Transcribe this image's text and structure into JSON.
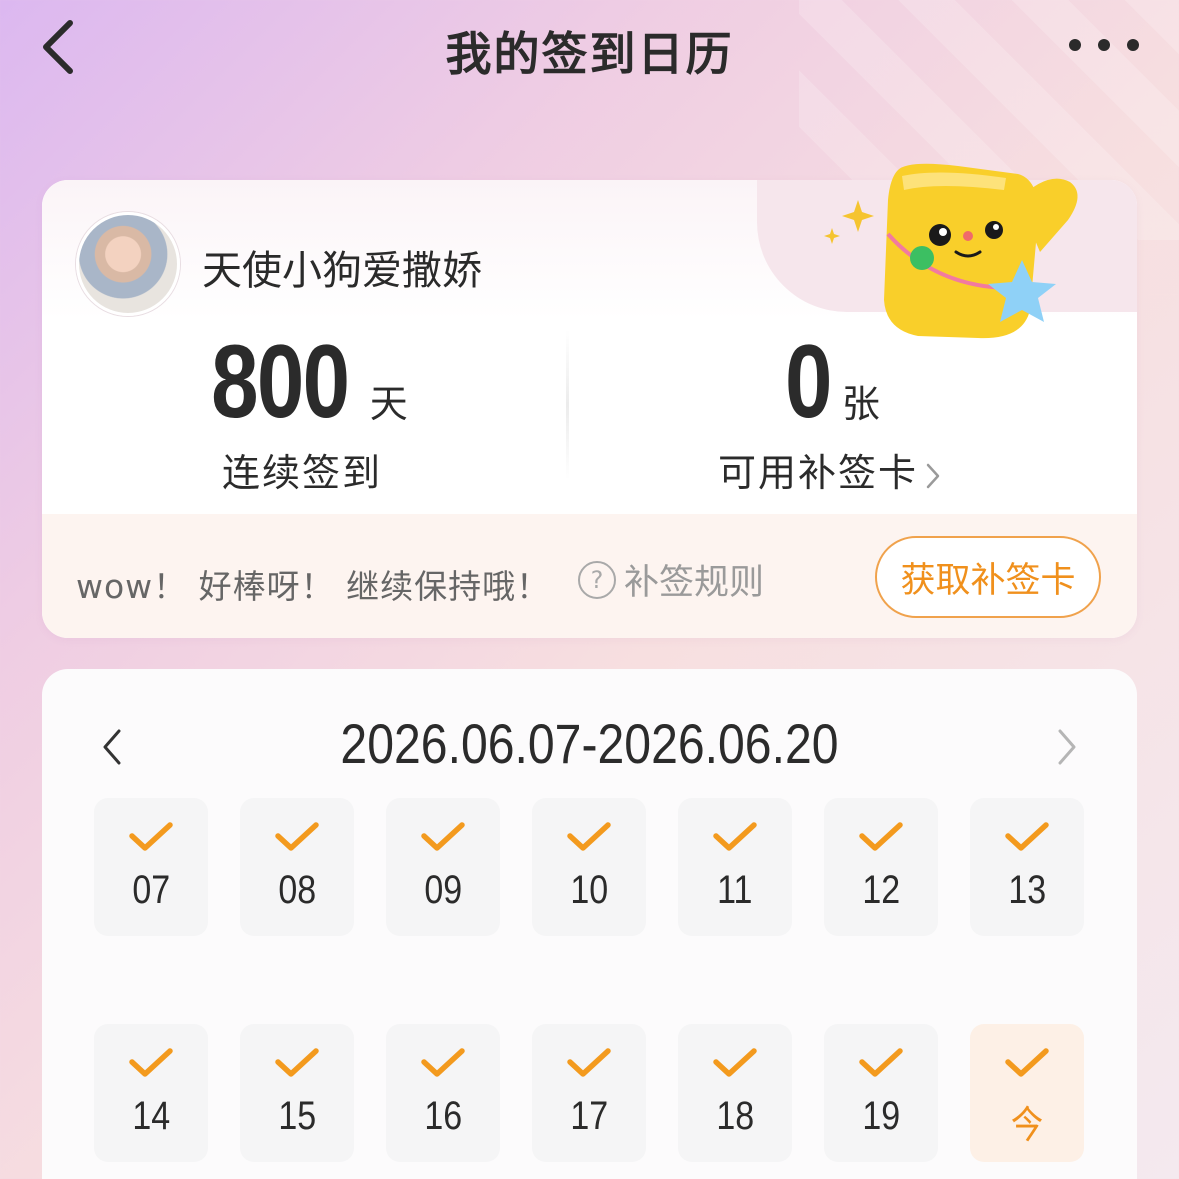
{
  "nav": {
    "title": "我的签到日历",
    "back_icon": "chevron-left-icon",
    "more_icon": "more-horizontal-icon"
  },
  "profile": {
    "username": "天使小狗爱撒娇",
    "streak_value": "800",
    "streak_unit": "天",
    "streak_label": "连续签到",
    "cards_value": "0",
    "cards_unit": "张",
    "cards_label": "可用补签卡"
  },
  "footer": {
    "encourage": "wow！ 好棒呀！ 继续保持哦！",
    "rules_label": "补签规则",
    "get_card_label": "获取补签卡"
  },
  "calendar": {
    "range": "2026.06.07-2026.06.20",
    "days": [
      {
        "label": "07",
        "checked": true,
        "today": false
      },
      {
        "label": "08",
        "checked": true,
        "today": false
      },
      {
        "label": "09",
        "checked": true,
        "today": false
      },
      {
        "label": "10",
        "checked": true,
        "today": false
      },
      {
        "label": "11",
        "checked": true,
        "today": false
      },
      {
        "label": "12",
        "checked": true,
        "today": false
      },
      {
        "label": "13",
        "checked": true,
        "today": false
      },
      {
        "label": "14",
        "checked": true,
        "today": false
      },
      {
        "label": "15",
        "checked": true,
        "today": false
      },
      {
        "label": "16",
        "checked": true,
        "today": false
      },
      {
        "label": "17",
        "checked": true,
        "today": false
      },
      {
        "label": "18",
        "checked": true,
        "today": false
      },
      {
        "label": "19",
        "checked": true,
        "today": false
      },
      {
        "label": "今",
        "checked": true,
        "today": true
      }
    ]
  },
  "colors": {
    "accent": "#f0901c",
    "check": "#f39a1e",
    "text": "#2b2b2b"
  }
}
